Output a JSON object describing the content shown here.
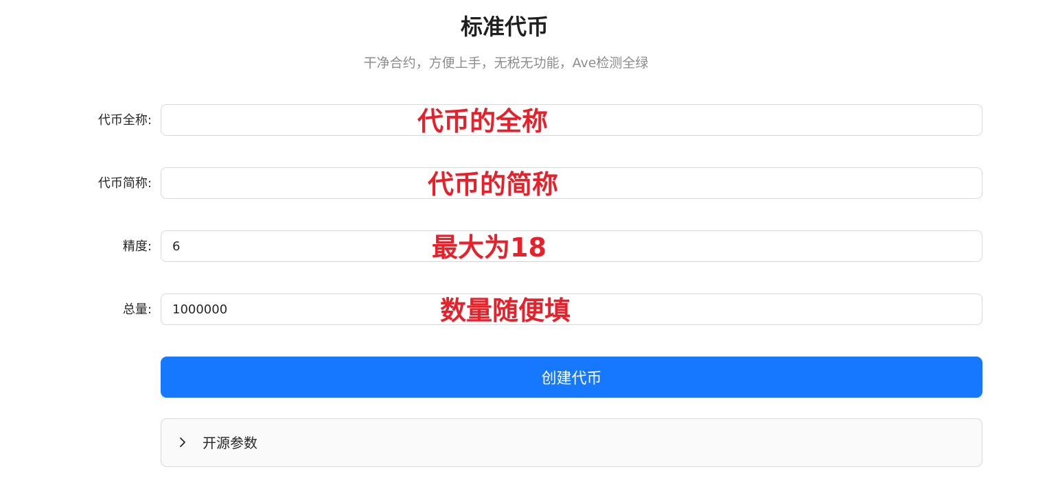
{
  "header": {
    "title": "标准代币",
    "subtitle": "干净合约，方便上手，无税无功能，Ave检测全绿"
  },
  "form": {
    "name": {
      "label": "代币全称:",
      "value": "",
      "annotation": "代币的全称"
    },
    "symbol": {
      "label": "代币简称:",
      "value": "",
      "annotation": "代币的简称"
    },
    "decimals": {
      "label": "精度:",
      "value": "6",
      "annotation": "最大为18"
    },
    "supply": {
      "label": "总量:",
      "value": "1000000",
      "annotation": "数量随便填"
    },
    "submit_label": "创建代币"
  },
  "open_source": {
    "label": "开源参数",
    "icon": "chevron-right-icon",
    "expanded": false
  },
  "colors": {
    "primary": "#1677ff",
    "annotation": "#e8202a",
    "subtitle": "#8c8c8c"
  }
}
